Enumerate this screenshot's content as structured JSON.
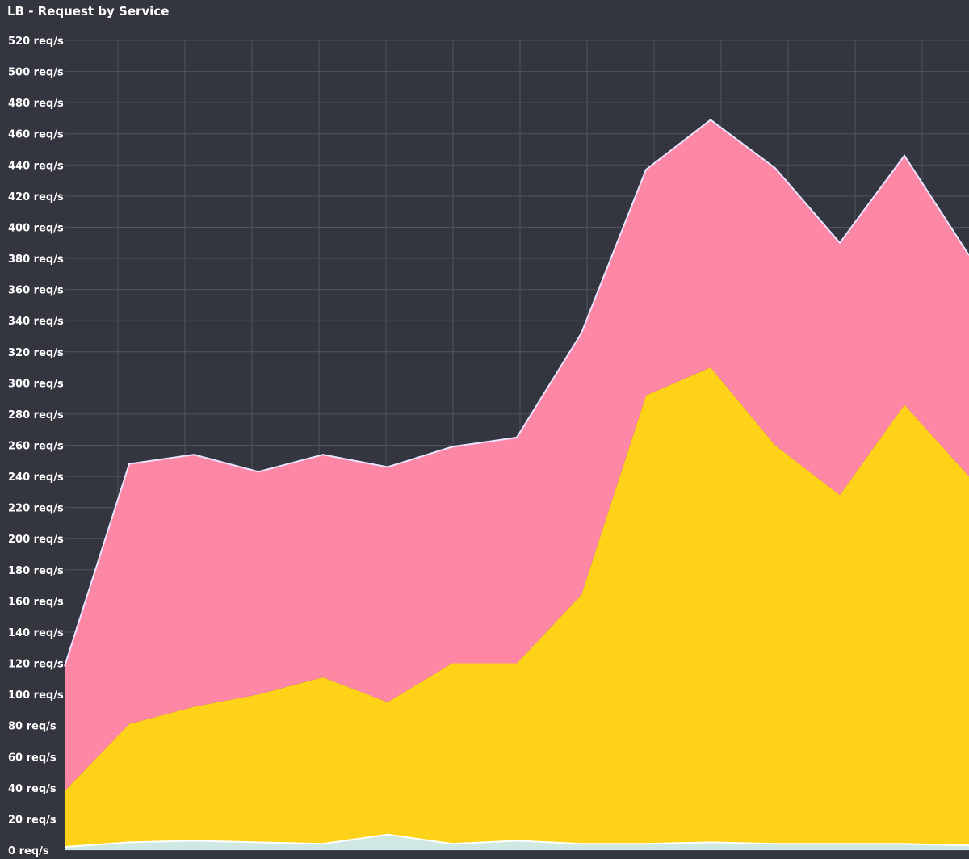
{
  "panel": {
    "title": "LB - Request by Service"
  },
  "chart_data": {
    "type": "area",
    "stacked": true,
    "title": "LB - Request by Service",
    "y_unit": "req/s",
    "ylim": [
      0,
      520
    ],
    "y_ticks": [
      {
        "value": 0,
        "label": "0 req/s"
      },
      {
        "value": 20,
        "label": "20 req/s"
      },
      {
        "value": 40,
        "label": "40 req/s"
      },
      {
        "value": 60,
        "label": "60 req/s"
      },
      {
        "value": 80,
        "label": "80 req/s"
      },
      {
        "value": 100,
        "label": "100 req/s"
      },
      {
        "value": 120,
        "label": "120 req/s"
      },
      {
        "value": 140,
        "label": "140 req/s"
      },
      {
        "value": 160,
        "label": "160 req/s"
      },
      {
        "value": 180,
        "label": "180 req/s"
      },
      {
        "value": 200,
        "label": "200 req/s"
      },
      {
        "value": 220,
        "label": "220 req/s"
      },
      {
        "value": 240,
        "label": "240 req/s"
      },
      {
        "value": 260,
        "label": "260 req/s"
      },
      {
        "value": 280,
        "label": "280 req/s"
      },
      {
        "value": 300,
        "label": "300 req/s"
      },
      {
        "value": 320,
        "label": "320 req/s"
      },
      {
        "value": 340,
        "label": "340 req/s"
      },
      {
        "value": 360,
        "label": "360 req/s"
      },
      {
        "value": 380,
        "label": "380 req/s"
      },
      {
        "value": 400,
        "label": "400 req/s"
      },
      {
        "value": 420,
        "label": "420 req/s"
      },
      {
        "value": 440,
        "label": "440 req/s"
      },
      {
        "value": 460,
        "label": "460 req/s"
      },
      {
        "value": 480,
        "label": "480 req/s"
      },
      {
        "value": 500,
        "label": "500 req/s"
      },
      {
        "value": 520,
        "label": "520 req/s"
      }
    ],
    "x_points": 15,
    "x_gridlines": 13,
    "grid": true,
    "legend": "none",
    "series": [
      {
        "color": "#cfe8e4",
        "values": [
          2,
          5,
          6,
          5,
          4,
          10,
          4,
          6,
          4,
          4,
          5,
          4,
          4,
          4,
          3
        ]
      },
      {
        "color": "#ffd21a",
        "values": [
          36,
          76,
          86,
          95,
          107,
          85,
          116,
          114,
          160,
          288,
          305,
          256,
          224,
          282,
          237
        ]
      },
      {
        "color": "#ff87a6",
        "values": [
          80,
          167,
          162,
          143,
          143,
          151,
          139,
          145,
          168,
          145,
          159,
          178,
          162,
          160,
          142
        ]
      }
    ],
    "outline_color": "#e8e4ff"
  }
}
